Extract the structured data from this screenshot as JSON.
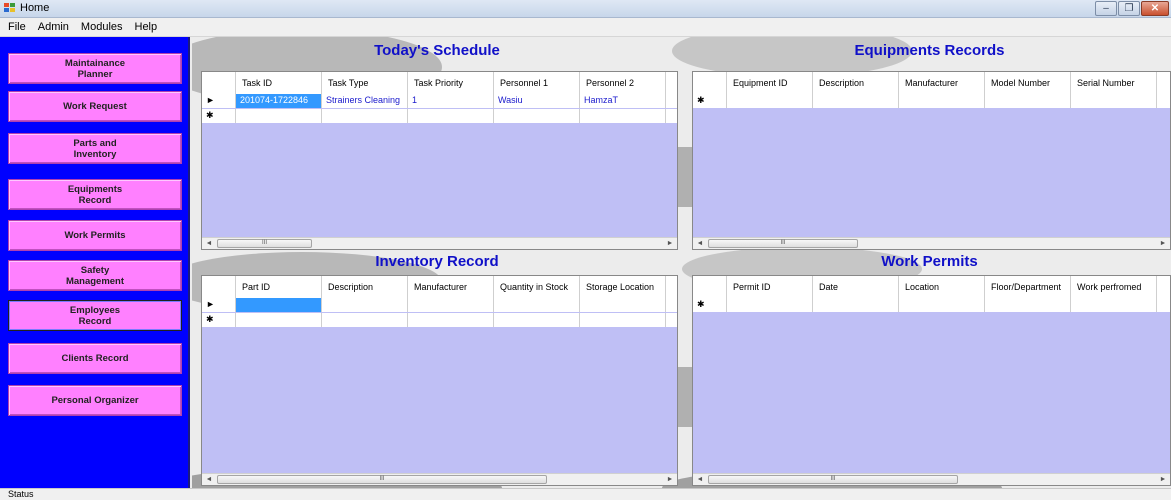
{
  "window": {
    "title": "Home"
  },
  "menu": [
    "File",
    "Admin",
    "Modules",
    "Help"
  ],
  "sidebar": {
    "items": [
      {
        "label": "Maintainance\nPlanner"
      },
      {
        "label": "Work Request"
      },
      {
        "label": "Parts and\nInventory"
      },
      {
        "label": "Equipments\nRecord"
      },
      {
        "label": "Work Permits"
      },
      {
        "label": "Safety\nManagement"
      },
      {
        "label": "Employees\nRecord"
      },
      {
        "label": "Clients Record"
      },
      {
        "label": "Personal Organizer"
      }
    ]
  },
  "schedule": {
    "title": "Today's Schedule",
    "columns": [
      "Task ID",
      "Task Type",
      "Task Priority",
      "Personnel 1",
      "Personnel 2"
    ],
    "rows": [
      {
        "marker": "►",
        "cells": [
          "201074-1722846",
          "Strainers Cleaning",
          "1",
          "Wasiu",
          "HamzaT"
        ]
      },
      {
        "marker": "✱",
        "cells": [
          "",
          "",
          "",
          "",
          ""
        ]
      }
    ]
  },
  "equipment": {
    "title": "Equipments Records",
    "columns": [
      "Equipment ID",
      "Description",
      "Manufacturer",
      "Model Number",
      "Serial Number"
    ],
    "rows": [
      {
        "marker": "✱",
        "cells": [
          "",
          "",
          "",
          "",
          ""
        ]
      }
    ]
  },
  "inventory": {
    "title": "Inventory Record",
    "columns": [
      "Part ID",
      "Description",
      "Manufacturer",
      "Quantity in Stock",
      "Storage Location"
    ],
    "rows": [
      {
        "marker": "►",
        "cells": [
          "",
          "",
          "",
          "",
          ""
        ]
      },
      {
        "marker": "✱",
        "cells": [
          "",
          "",
          "",
          "",
          ""
        ]
      }
    ]
  },
  "permits": {
    "title": "Work Permits",
    "columns": [
      "Permit ID",
      "Date",
      "Location",
      "Floor/Department",
      "Work perfromed"
    ],
    "rows": [
      {
        "marker": "✱",
        "cells": [
          "",
          "",
          "",
          "",
          ""
        ]
      }
    ]
  },
  "scrollbar": {
    "thumb_grip": "III"
  },
  "status": {
    "text": "Status"
  },
  "colors": {
    "sidebar_bg": "#0000ff",
    "button_bg": "#ff80ff",
    "title_color": "#1010c8",
    "grid_bg": "#bfbff5"
  }
}
